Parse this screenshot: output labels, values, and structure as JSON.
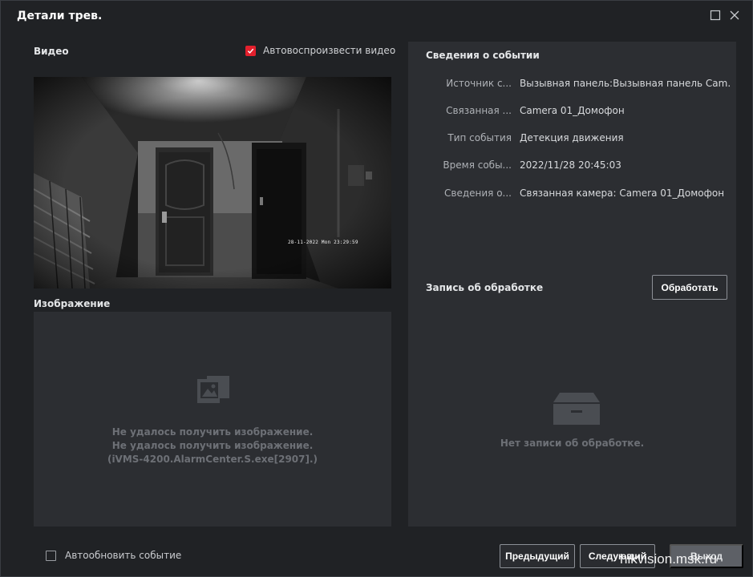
{
  "window": {
    "title": "Детали трев."
  },
  "video": {
    "label": "Видео",
    "autoplay_label": "Автовоспроизвести видео",
    "autoplay_checked": true,
    "osd_timestamp": "28-11-2022 Mon 23:29:59"
  },
  "image": {
    "label": "Изображение",
    "message_lines": [
      "Не удалось получить изображение.",
      "Не удалось получить изображение.",
      "(iVMS-4200.AlarmCenter.S.exe[2907].)"
    ]
  },
  "event_info": {
    "title": "Сведения о событии",
    "rows": [
      {
        "key": "Источник с...",
        "value": "Вызывная панель:Вызывная панель Cam..."
      },
      {
        "key": "Связанная ...",
        "value": "Camera 01_Домофон"
      },
      {
        "key": "Тип события",
        "value": "Детекция движения"
      },
      {
        "key": "Время собы...",
        "value": "2022/11/28 20:45:03"
      },
      {
        "key": "Сведения о...",
        "value": "Связанная камера: Camera 01_Домофон"
      }
    ]
  },
  "handling": {
    "title": "Запись об обработке",
    "process_button": "Обработать",
    "empty_message": "Нет записи об обработке."
  },
  "footer": {
    "auto_update_label": "Автообновить событие",
    "auto_update_checked": false,
    "prev_button": "Предыдущий",
    "next_button": "Следующий",
    "exit_button": "Выход"
  },
  "watermark": "hikvision.msk.ru",
  "colors": {
    "background": "#202225",
    "panel": "#2c2e32",
    "accent_red": "#e3202d",
    "muted_text": "#6d7076"
  }
}
